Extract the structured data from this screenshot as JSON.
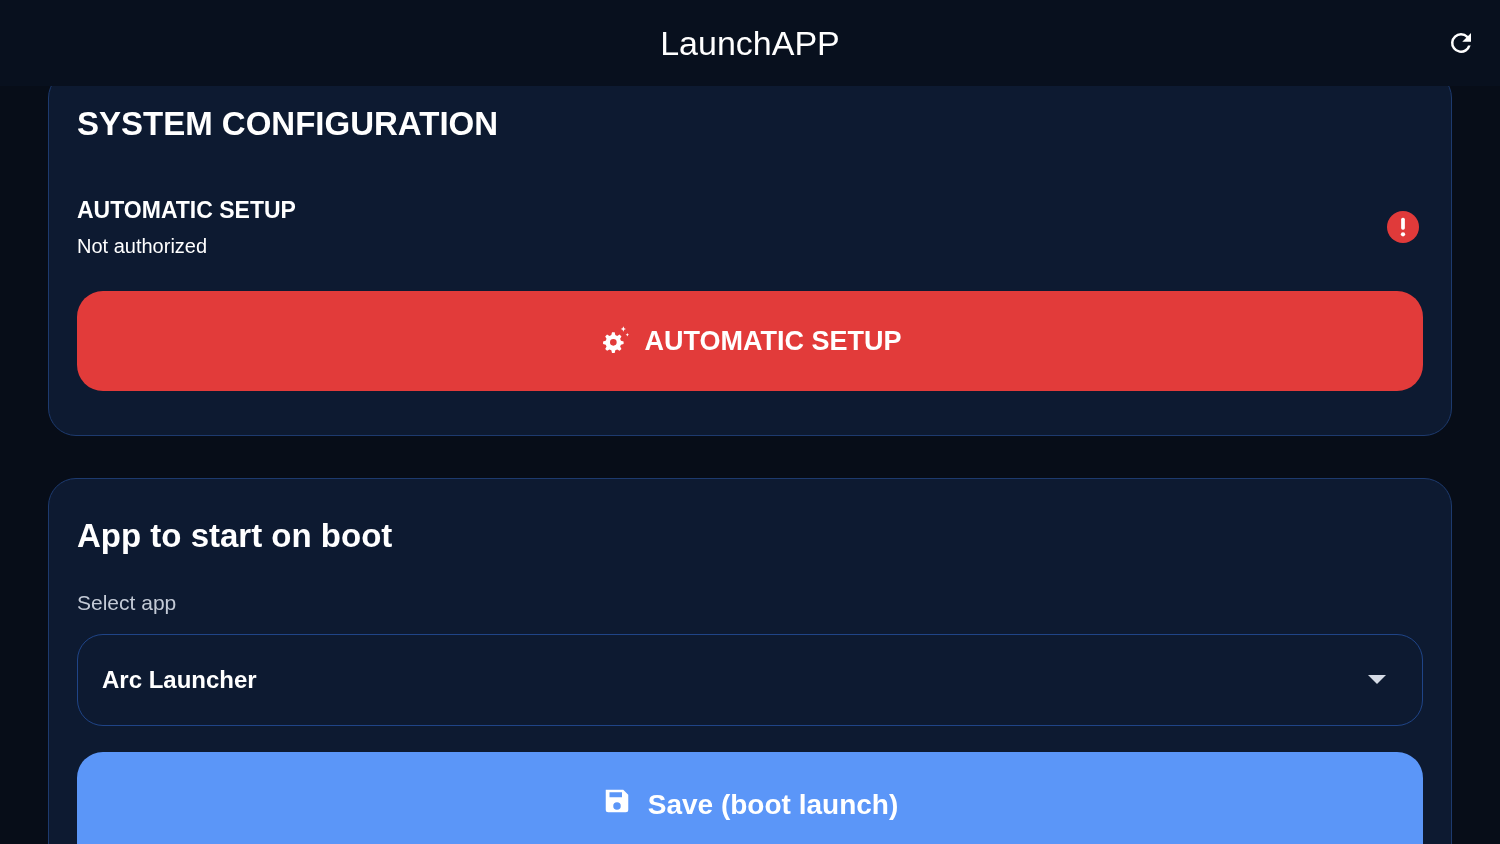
{
  "app_bar": {
    "title": "LaunchAPP"
  },
  "system_configuration": {
    "title": "SYSTEM CONFIGURATION",
    "status": {
      "label": "AUTOMATIC SETUP",
      "value": "Not authorized",
      "authorized": false
    },
    "button": {
      "label": "AUTOMATIC SETUP",
      "kind": "danger"
    }
  },
  "boot_app": {
    "title": "App to start on boot",
    "select": {
      "label": "Select app",
      "value": "Arc Launcher"
    },
    "button": {
      "label": "Save (boot launch)",
      "kind": "primary"
    }
  }
}
